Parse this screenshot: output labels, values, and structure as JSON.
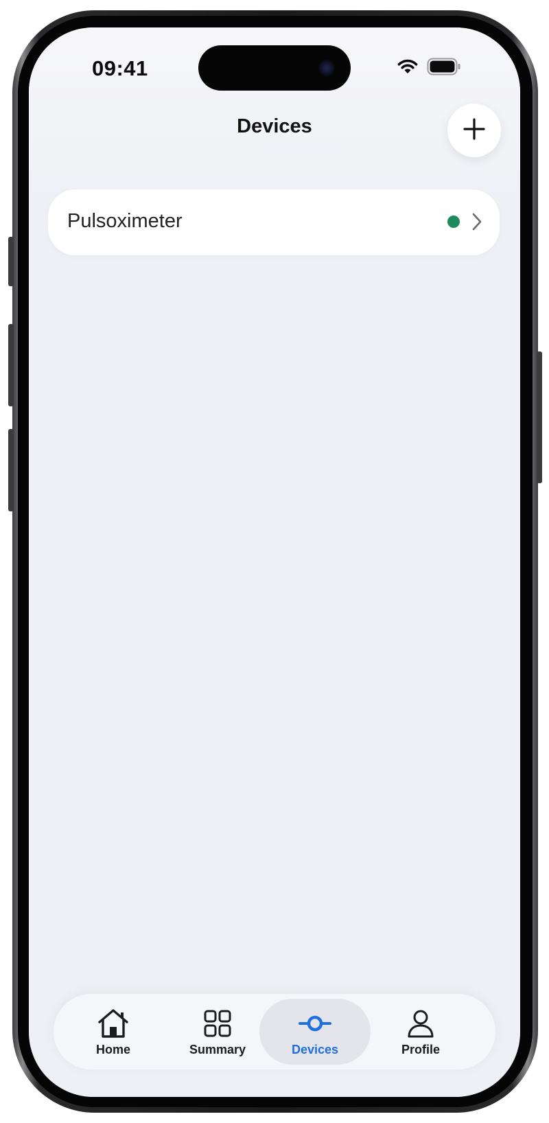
{
  "status_bar": {
    "time": "09:41",
    "icons": [
      "wifi-icon",
      "battery-icon"
    ]
  },
  "nav": {
    "title": "Devices",
    "add_icon": "plus-icon"
  },
  "devices": [
    {
      "name": "Pulsoximeter",
      "status_color": "#1f8a5b",
      "icon": "chevron-right-icon"
    }
  ],
  "tabs": [
    {
      "label": "Home",
      "icon": "home-icon",
      "active": false
    },
    {
      "label": "Summary",
      "icon": "grid-icon",
      "active": false
    },
    {
      "label": "Devices",
      "icon": "devices-icon",
      "active": true
    },
    {
      "label": "Profile",
      "icon": "person-icon",
      "active": false
    }
  ],
  "colors": {
    "accent": "#1f6fe0",
    "background": "#eef0f5",
    "connected": "#1f8a5b"
  }
}
